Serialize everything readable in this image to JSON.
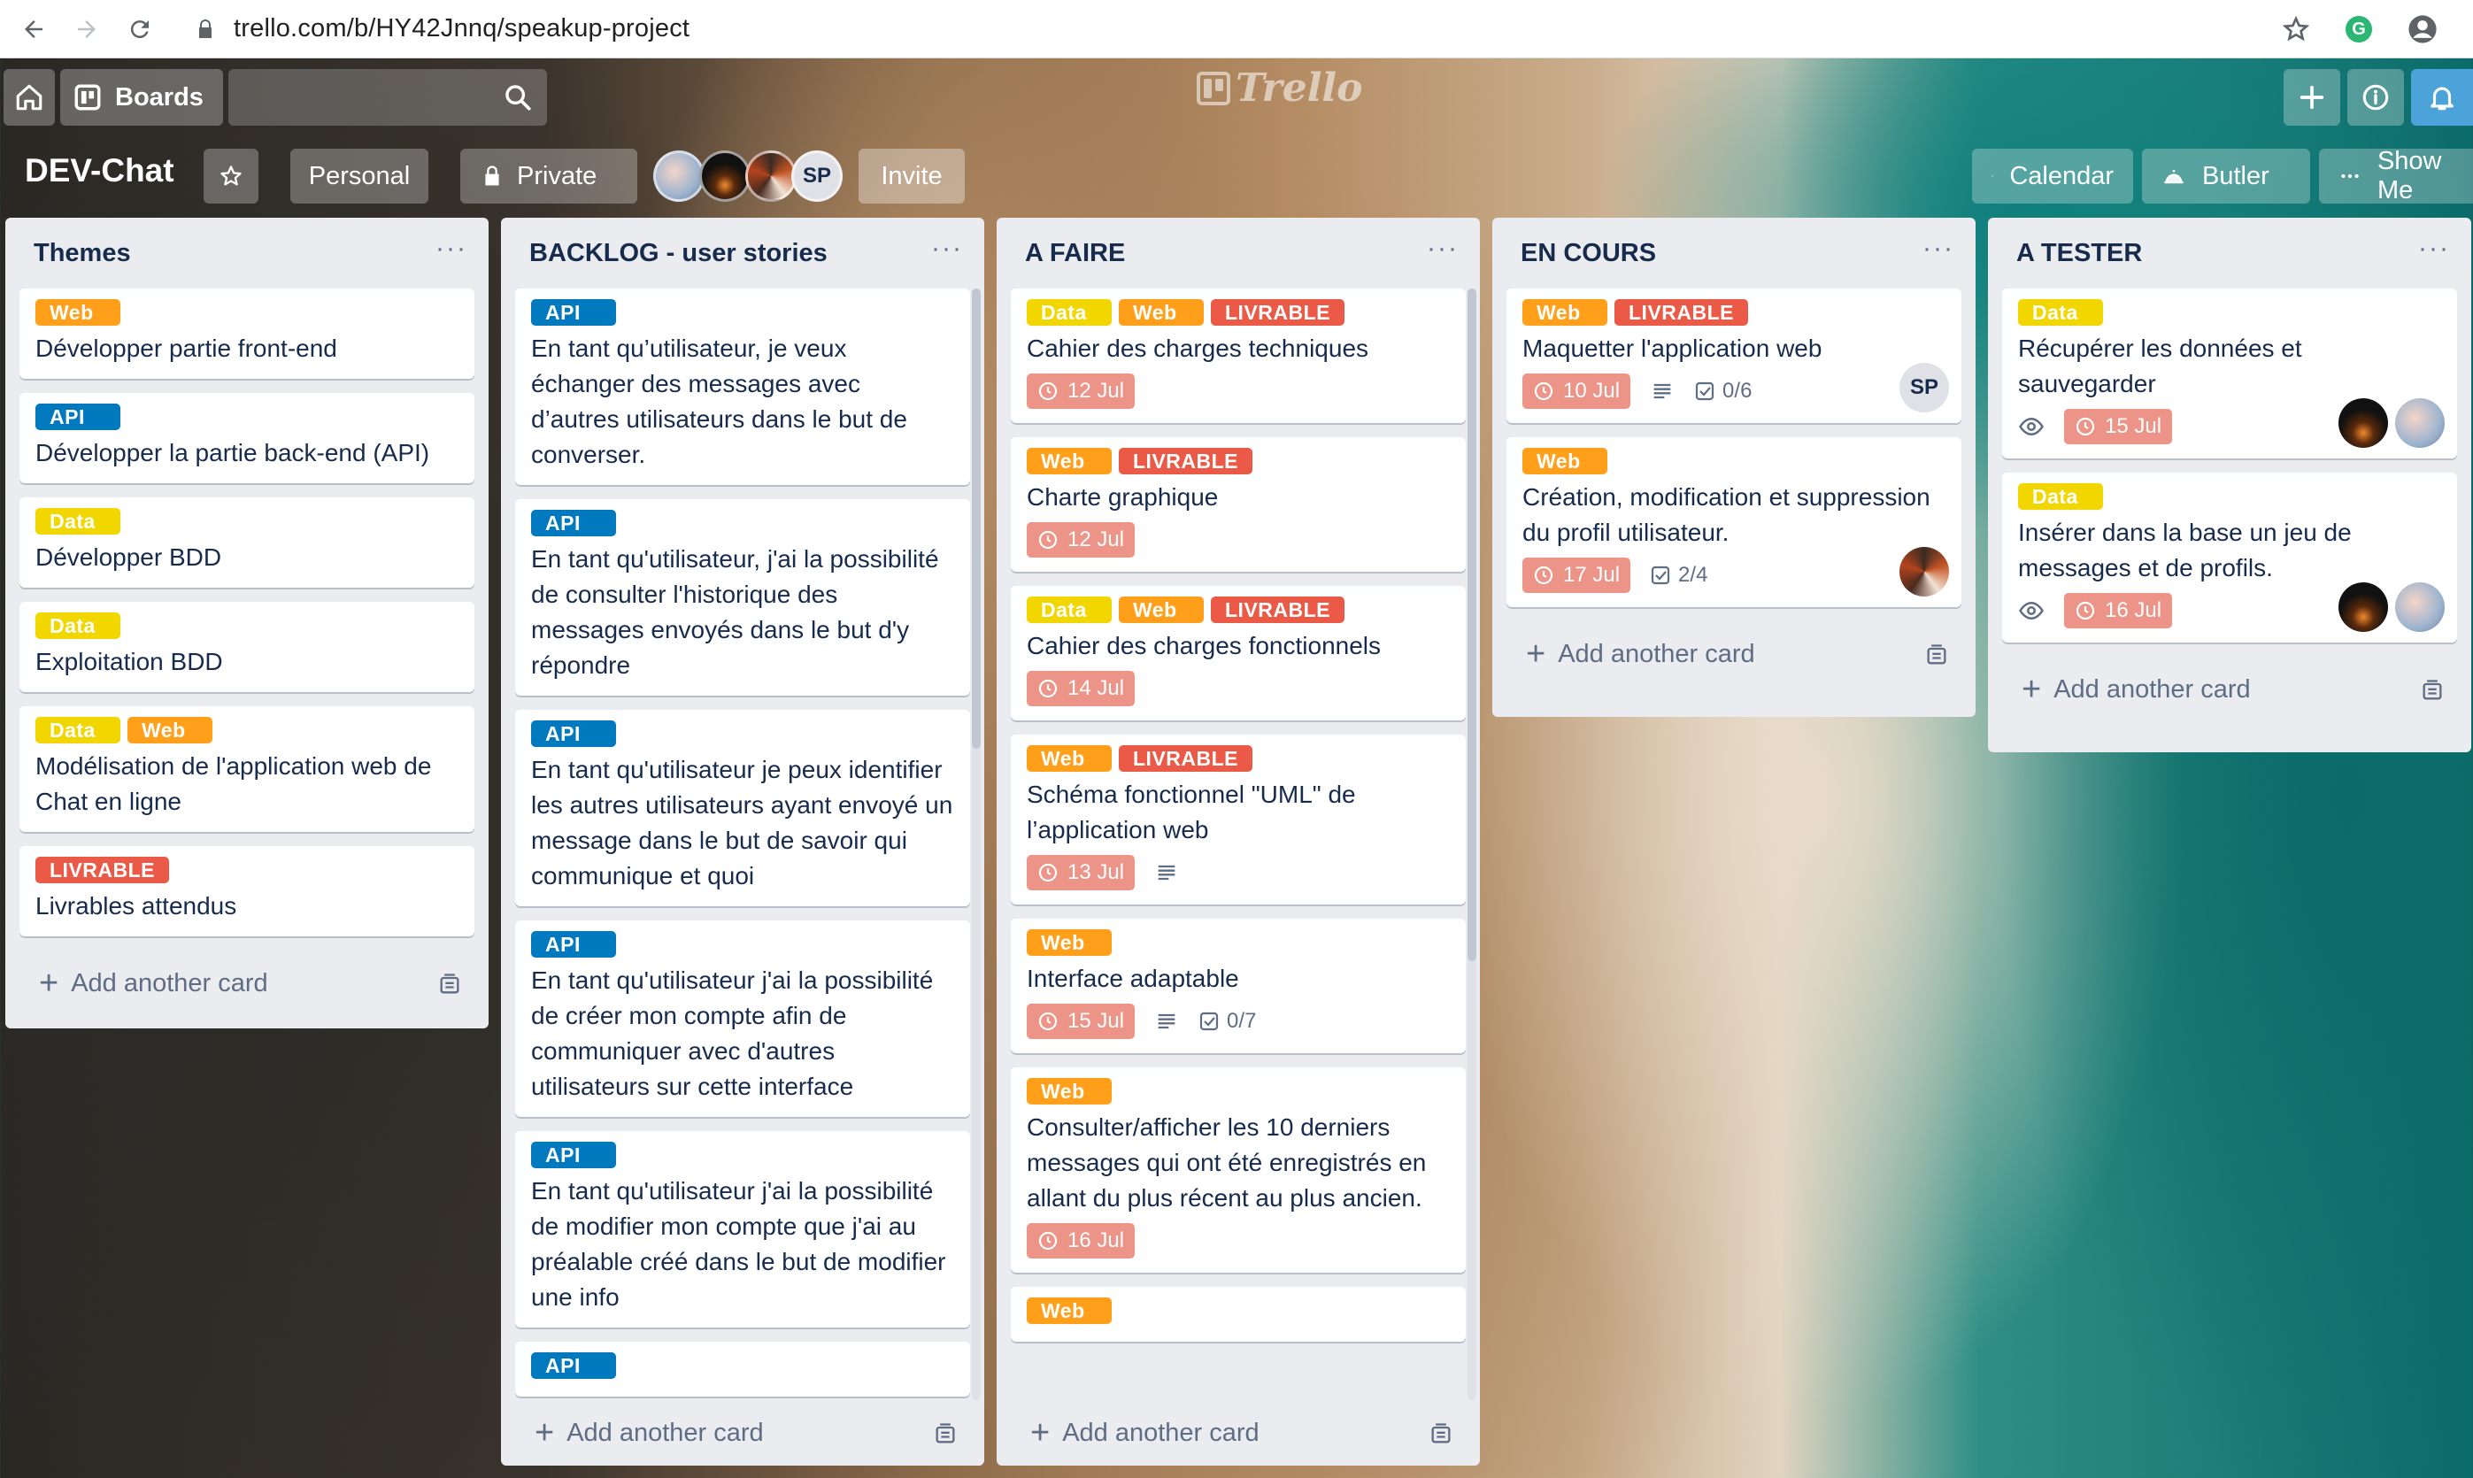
{
  "browser": {
    "url": "trello.com/b/HY42Jnnq/speakup-project",
    "extension_letter": "G"
  },
  "header": {
    "boards_label": "Boards",
    "logo_text": "Trello"
  },
  "board": {
    "title": "DEV-Chat",
    "visibility_team": "Personal",
    "visibility": "Private",
    "invite_label": "Invite",
    "member_initials": "SP",
    "calendar_label": "Calendar",
    "butler_label": "Butler",
    "show_menu_label": "Show Me"
  },
  "add_card_label": "Add another card",
  "lists": [
    {
      "title": "Themes",
      "cards": [
        {
          "labels": [
            "Web"
          ],
          "title": "Développer partie front-end"
        },
        {
          "labels": [
            "API"
          ],
          "title": "Développer la partie back-end (API)"
        },
        {
          "labels": [
            "Data"
          ],
          "title": "Développer BDD"
        },
        {
          "labels": [
            "Data"
          ],
          "title": "Exploitation BDD"
        },
        {
          "labels": [
            "Data",
            "Web"
          ],
          "title": "Modélisation de l'application web de Chat en ligne"
        },
        {
          "labels": [
            "LIVRABLE"
          ],
          "title": "Livrables attendus"
        }
      ]
    },
    {
      "title": "BACKLOG - user stories",
      "cards": [
        {
          "labels": [
            "API"
          ],
          "title": "En tant qu’utilisateur, je veux échanger des messages avec d’autres utilisateurs dans le but de converser."
        },
        {
          "labels": [
            "API"
          ],
          "title": "En tant qu'utilisateur, j'ai la possibilité de consulter l'historique des messages envoyés dans le but d'y répondre"
        },
        {
          "labels": [
            "API"
          ],
          "title": "En tant qu'utilisateur je peux identifier les autres utilisateurs ayant envoyé un message dans le but de savoir qui communique et quoi"
        },
        {
          "labels": [
            "API"
          ],
          "title": "En tant qu'utilisateur j'ai la possibilité de créer mon compte afin de communiquer avec d'autres utilisateurs sur cette interface"
        },
        {
          "labels": [
            "API"
          ],
          "title": "En tant qu'utilisateur j'ai la possibilité de modifier mon compte que j'ai au préalable créé dans le but de modifier une info"
        },
        {
          "labels": [
            "API"
          ],
          "title": ""
        }
      ]
    },
    {
      "title": "A FAIRE",
      "cards": [
        {
          "labels": [
            "Data",
            "Web",
            "LIVRABLE"
          ],
          "title": "Cahier des charges techniques",
          "due": "12 Jul"
        },
        {
          "labels": [
            "Web",
            "LIVRABLE"
          ],
          "title": "Charte graphique",
          "due": "12 Jul"
        },
        {
          "labels": [
            "Data",
            "Web",
            "LIVRABLE"
          ],
          "title": "Cahier des charges fonctionnels",
          "due": "14 Jul"
        },
        {
          "labels": [
            "Web",
            "LIVRABLE"
          ],
          "title": "Schéma fonctionnel \"UML\" de l’application web",
          "due": "13 Jul",
          "has_description": true
        },
        {
          "labels": [
            "Web"
          ],
          "title": "Interface adaptable",
          "due": "15 Jul",
          "has_description": true,
          "checklist": "0/7"
        },
        {
          "labels": [
            "Web"
          ],
          "title": "Consulter/afficher les 10 derniers messages qui ont été enregistrés en allant du plus récent au plus ancien.",
          "due": "16 Jul"
        },
        {
          "labels": [
            "Web"
          ],
          "title": ""
        }
      ]
    },
    {
      "title": "EN COURS",
      "cards": [
        {
          "labels": [
            "Web",
            "LIVRABLE"
          ],
          "title": "Maquetter l'application web",
          "due": "10 Jul",
          "has_description": true,
          "checklist": "0/6",
          "members": [
            "SP"
          ]
        },
        {
          "labels": [
            "Web"
          ],
          "title": "Création, modification et suppression du profil utilisateur.",
          "due": "17 Jul",
          "checklist": "2/4",
          "members": [
            "avatar-red"
          ]
        }
      ]
    },
    {
      "title": "A TESTER",
      "cards": [
        {
          "labels": [
            "Data"
          ],
          "title": "Récupérer les données et sauvegarder",
          "due": "15 Jul",
          "watching": true,
          "members": [
            "avatar-dark",
            "avatar-pastel"
          ]
        },
        {
          "labels": [
            "Data"
          ],
          "title": "Insérer dans la base un jeu de messages et de profils.",
          "due": "16 Jul",
          "watching": true,
          "members": [
            "avatar-dark",
            "avatar-pastel"
          ]
        }
      ]
    }
  ],
  "colors": {
    "Web": "#ff9f1a",
    "API": "#0079bf",
    "Data": "#f2d600",
    "LIVRABLE": "#eb5a46",
    "due_overdue": "#ec9488",
    "list_bg": "#ebecf0"
  }
}
